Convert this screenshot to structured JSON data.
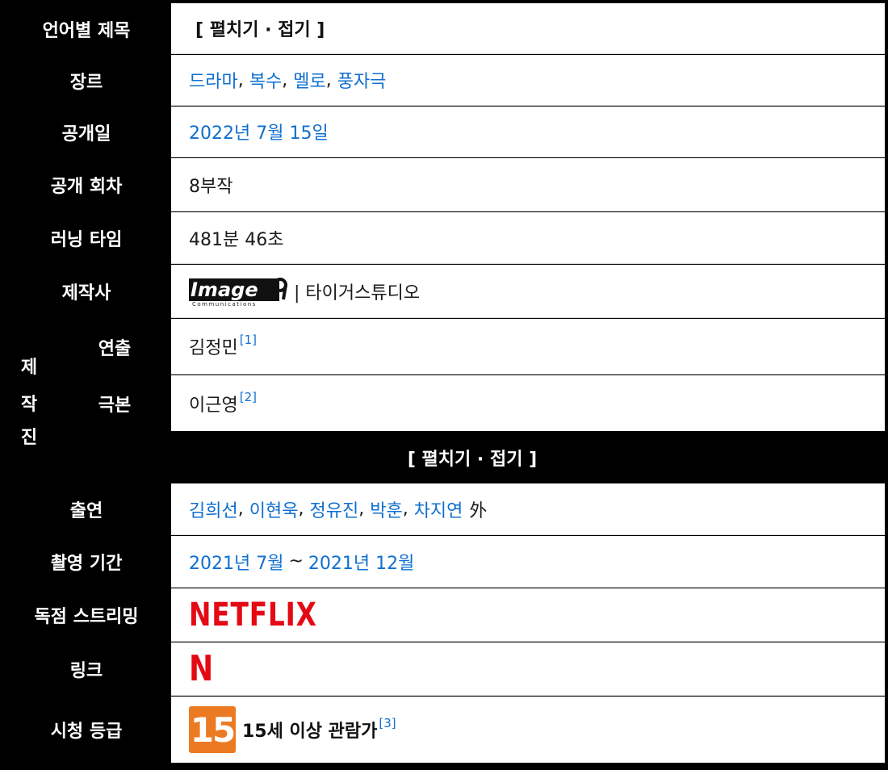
{
  "rows": {
    "title_by_language": {
      "label": "언어별 제목",
      "value": "[ 펼치기 · 접기 ]"
    },
    "genre": {
      "label": "장르",
      "items": [
        "드라마",
        "복수",
        "멜로",
        "풍자극"
      ],
      "sep": ", "
    },
    "release_date": {
      "label": "공개일",
      "value": "2022년 7월 15일"
    },
    "episodes": {
      "label": "공개 회차",
      "value": "8부작"
    },
    "running_time": {
      "label": "러닝 타임",
      "value": "481분 46초"
    },
    "production_company": {
      "label": "제작사",
      "logo_text": "Image",
      "logo_sub": "Communications",
      "value": "| 타이거스튜디오"
    },
    "production_staff": {
      "group_label": [
        "제",
        "작",
        "진"
      ],
      "director": {
        "label": "연출",
        "value": "김정민",
        "ref": "[1]"
      },
      "screenplay": {
        "label": "극본",
        "value": "이근영",
        "ref": "[2]"
      },
      "folded": "[ 펼치기 · 접기 ]"
    },
    "cast": {
      "label": "출연",
      "items": [
        "김희선",
        "이현욱",
        "정유진",
        "박훈",
        "차지연"
      ],
      "sep": ", ",
      "suffix": "外"
    },
    "filming_period": {
      "label": "촬영 기간",
      "start": "2021년 7월",
      "tilde": "~",
      "end": "2021년 12월"
    },
    "exclusive_streaming": {
      "label": "독점 스트리밍",
      "logo_text": "NETFLIX"
    },
    "link": {
      "label": "링크",
      "logo_text": "N"
    },
    "rating": {
      "label": "시청 등급",
      "badge": "15",
      "value": "15세 이상 관람가",
      "ref": "[3]"
    }
  },
  "colors": {
    "label_bg": "#000000",
    "link": "#0f6fd0",
    "netflix_red": "#e50914",
    "rating_badge": "#ec7a23"
  }
}
